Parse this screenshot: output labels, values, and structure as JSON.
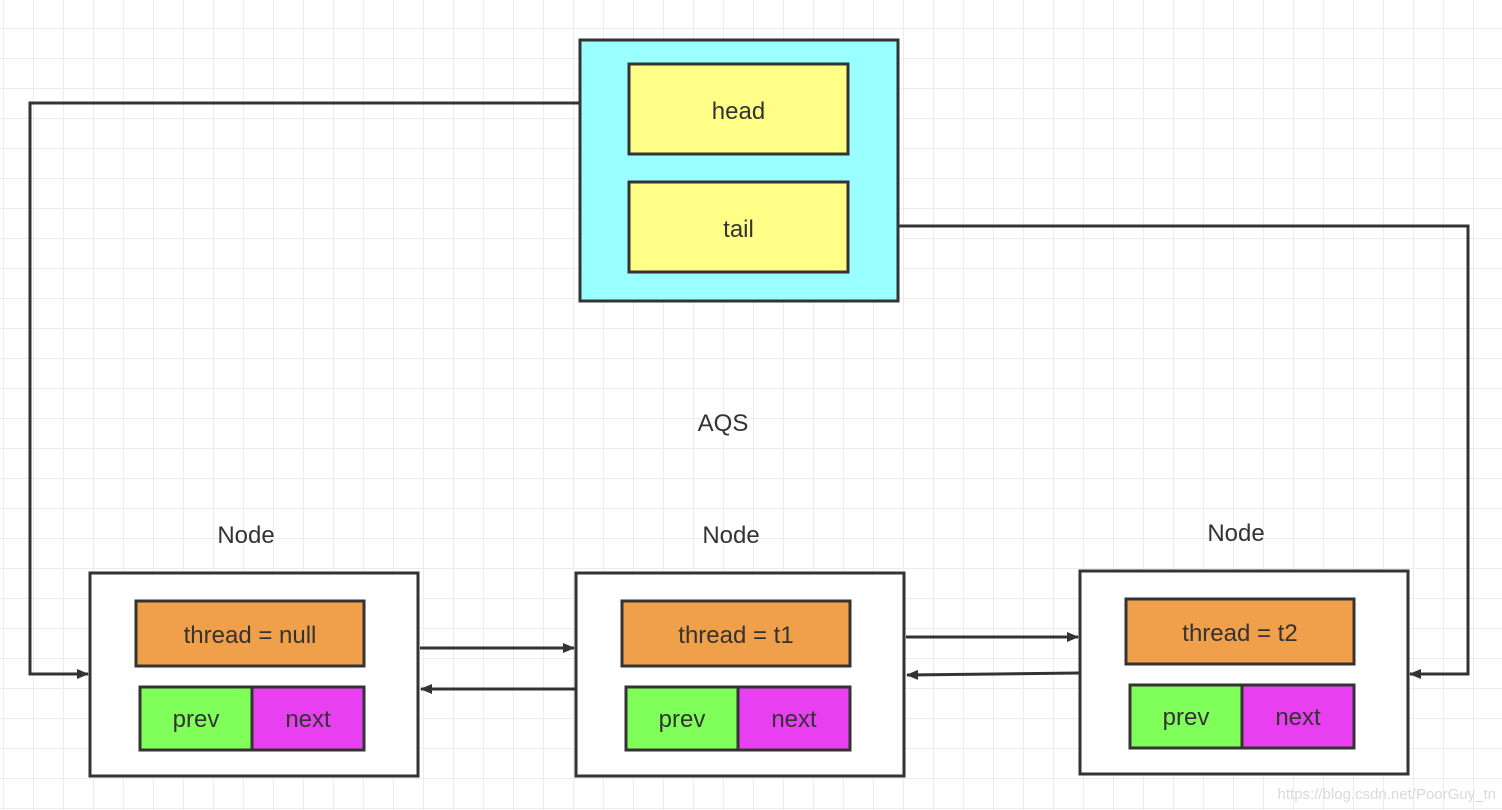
{
  "colors": {
    "aqs_fill": "#99ffff",
    "field_fill": "#ffff88",
    "thread_fill": "#f0a04b",
    "prev_fill": "#80ff5a",
    "next_fill": "#e83ff0",
    "line": "#333333",
    "grid": "#ececec"
  },
  "aqs": {
    "label": "AQS",
    "head": "head",
    "tail": "tail"
  },
  "nodes": [
    {
      "title": "Node",
      "thread": "thread = null",
      "prev": "prev",
      "next": "next"
    },
    {
      "title": "Node",
      "thread": "thread = t1",
      "prev": "prev",
      "next": "next"
    },
    {
      "title": "Node",
      "thread": "thread = t2",
      "prev": "prev",
      "next": "next"
    }
  ],
  "watermark": "https://blog.csdn.net/PoorGuy_tn"
}
